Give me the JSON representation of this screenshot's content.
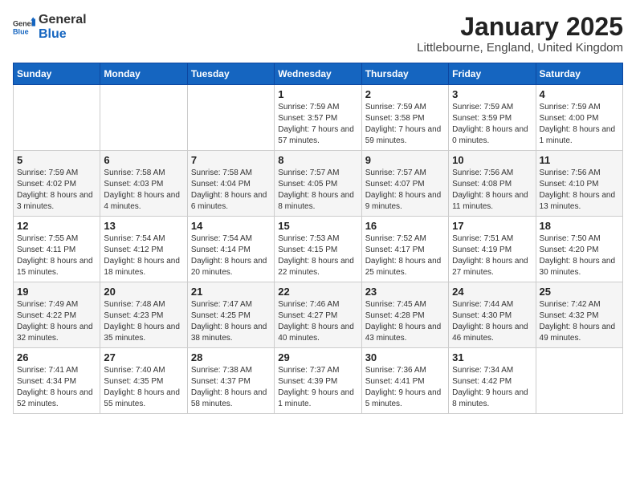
{
  "header": {
    "logo_general": "General",
    "logo_blue": "Blue",
    "title": "January 2025",
    "subtitle": "Littlebourne, England, United Kingdom"
  },
  "weekdays": [
    "Sunday",
    "Monday",
    "Tuesday",
    "Wednesday",
    "Thursday",
    "Friday",
    "Saturday"
  ],
  "weeks": [
    [
      {
        "day": null
      },
      {
        "day": null
      },
      {
        "day": null
      },
      {
        "day": "1",
        "sunrise": "Sunrise: 7:59 AM",
        "sunset": "Sunset: 3:57 PM",
        "daylight": "Daylight: 7 hours and 57 minutes."
      },
      {
        "day": "2",
        "sunrise": "Sunrise: 7:59 AM",
        "sunset": "Sunset: 3:58 PM",
        "daylight": "Daylight: 7 hours and 59 minutes."
      },
      {
        "day": "3",
        "sunrise": "Sunrise: 7:59 AM",
        "sunset": "Sunset: 3:59 PM",
        "daylight": "Daylight: 8 hours and 0 minutes."
      },
      {
        "day": "4",
        "sunrise": "Sunrise: 7:59 AM",
        "sunset": "Sunset: 4:00 PM",
        "daylight": "Daylight: 8 hours and 1 minute."
      }
    ],
    [
      {
        "day": "5",
        "sunrise": "Sunrise: 7:59 AM",
        "sunset": "Sunset: 4:02 PM",
        "daylight": "Daylight: 8 hours and 3 minutes."
      },
      {
        "day": "6",
        "sunrise": "Sunrise: 7:58 AM",
        "sunset": "Sunset: 4:03 PM",
        "daylight": "Daylight: 8 hours and 4 minutes."
      },
      {
        "day": "7",
        "sunrise": "Sunrise: 7:58 AM",
        "sunset": "Sunset: 4:04 PM",
        "daylight": "Daylight: 8 hours and 6 minutes."
      },
      {
        "day": "8",
        "sunrise": "Sunrise: 7:57 AM",
        "sunset": "Sunset: 4:05 PM",
        "daylight": "Daylight: 8 hours and 8 minutes."
      },
      {
        "day": "9",
        "sunrise": "Sunrise: 7:57 AM",
        "sunset": "Sunset: 4:07 PM",
        "daylight": "Daylight: 8 hours and 9 minutes."
      },
      {
        "day": "10",
        "sunrise": "Sunrise: 7:56 AM",
        "sunset": "Sunset: 4:08 PM",
        "daylight": "Daylight: 8 hours and 11 minutes."
      },
      {
        "day": "11",
        "sunrise": "Sunrise: 7:56 AM",
        "sunset": "Sunset: 4:10 PM",
        "daylight": "Daylight: 8 hours and 13 minutes."
      }
    ],
    [
      {
        "day": "12",
        "sunrise": "Sunrise: 7:55 AM",
        "sunset": "Sunset: 4:11 PM",
        "daylight": "Daylight: 8 hours and 15 minutes."
      },
      {
        "day": "13",
        "sunrise": "Sunrise: 7:54 AM",
        "sunset": "Sunset: 4:12 PM",
        "daylight": "Daylight: 8 hours and 18 minutes."
      },
      {
        "day": "14",
        "sunrise": "Sunrise: 7:54 AM",
        "sunset": "Sunset: 4:14 PM",
        "daylight": "Daylight: 8 hours and 20 minutes."
      },
      {
        "day": "15",
        "sunrise": "Sunrise: 7:53 AM",
        "sunset": "Sunset: 4:15 PM",
        "daylight": "Daylight: 8 hours and 22 minutes."
      },
      {
        "day": "16",
        "sunrise": "Sunrise: 7:52 AM",
        "sunset": "Sunset: 4:17 PM",
        "daylight": "Daylight: 8 hours and 25 minutes."
      },
      {
        "day": "17",
        "sunrise": "Sunrise: 7:51 AM",
        "sunset": "Sunset: 4:19 PM",
        "daylight": "Daylight: 8 hours and 27 minutes."
      },
      {
        "day": "18",
        "sunrise": "Sunrise: 7:50 AM",
        "sunset": "Sunset: 4:20 PM",
        "daylight": "Daylight: 8 hours and 30 minutes."
      }
    ],
    [
      {
        "day": "19",
        "sunrise": "Sunrise: 7:49 AM",
        "sunset": "Sunset: 4:22 PM",
        "daylight": "Daylight: 8 hours and 32 minutes."
      },
      {
        "day": "20",
        "sunrise": "Sunrise: 7:48 AM",
        "sunset": "Sunset: 4:23 PM",
        "daylight": "Daylight: 8 hours and 35 minutes."
      },
      {
        "day": "21",
        "sunrise": "Sunrise: 7:47 AM",
        "sunset": "Sunset: 4:25 PM",
        "daylight": "Daylight: 8 hours and 38 minutes."
      },
      {
        "day": "22",
        "sunrise": "Sunrise: 7:46 AM",
        "sunset": "Sunset: 4:27 PM",
        "daylight": "Daylight: 8 hours and 40 minutes."
      },
      {
        "day": "23",
        "sunrise": "Sunrise: 7:45 AM",
        "sunset": "Sunset: 4:28 PM",
        "daylight": "Daylight: 8 hours and 43 minutes."
      },
      {
        "day": "24",
        "sunrise": "Sunrise: 7:44 AM",
        "sunset": "Sunset: 4:30 PM",
        "daylight": "Daylight: 8 hours and 46 minutes."
      },
      {
        "day": "25",
        "sunrise": "Sunrise: 7:42 AM",
        "sunset": "Sunset: 4:32 PM",
        "daylight": "Daylight: 8 hours and 49 minutes."
      }
    ],
    [
      {
        "day": "26",
        "sunrise": "Sunrise: 7:41 AM",
        "sunset": "Sunset: 4:34 PM",
        "daylight": "Daylight: 8 hours and 52 minutes."
      },
      {
        "day": "27",
        "sunrise": "Sunrise: 7:40 AM",
        "sunset": "Sunset: 4:35 PM",
        "daylight": "Daylight: 8 hours and 55 minutes."
      },
      {
        "day": "28",
        "sunrise": "Sunrise: 7:38 AM",
        "sunset": "Sunset: 4:37 PM",
        "daylight": "Daylight: 8 hours and 58 minutes."
      },
      {
        "day": "29",
        "sunrise": "Sunrise: 7:37 AM",
        "sunset": "Sunset: 4:39 PM",
        "daylight": "Daylight: 9 hours and 1 minute."
      },
      {
        "day": "30",
        "sunrise": "Sunrise: 7:36 AM",
        "sunset": "Sunset: 4:41 PM",
        "daylight": "Daylight: 9 hours and 5 minutes."
      },
      {
        "day": "31",
        "sunrise": "Sunrise: 7:34 AM",
        "sunset": "Sunset: 4:42 PM",
        "daylight": "Daylight: 9 hours and 8 minutes."
      },
      {
        "day": null
      }
    ]
  ]
}
